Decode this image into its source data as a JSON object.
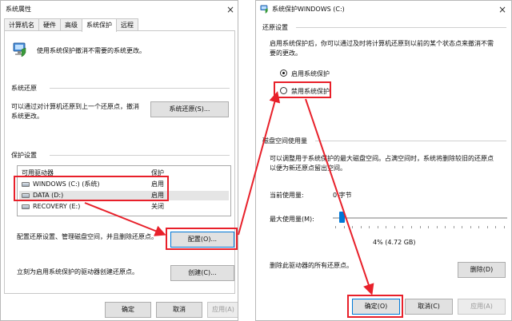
{
  "left_window": {
    "title": "系统属性",
    "close_glyph": "×",
    "tabs": [
      "计算机名",
      "硬件",
      "高级",
      "系统保护",
      "远程"
    ],
    "active_tab": "系统保护",
    "intro_text": "使用系统保护撤消不需要的系统更改。",
    "system_restore": {
      "section_label": "系统还原",
      "desc_line1": "可以通过对计算机还原到上一个还原点，撤消",
      "desc_line2": "系统更改。",
      "button_label": "系统还原(S)..."
    },
    "protection_settings": {
      "section_label": "保护设置",
      "col_drive": "可用驱动器",
      "col_protection": "保护",
      "drives": [
        {
          "name": "WINDOWS (C:) (系统)",
          "status": "启用"
        },
        {
          "name": "DATA (D:)",
          "status": "启用"
        },
        {
          "name": "RECOVERY (E:)",
          "status": "关闭"
        }
      ],
      "configure_text": "配置还原设置、管理磁盘空间，并且删除还原点。",
      "configure_button": "配置(O)...",
      "create_text": "立刻为启用系统保护的驱动器创建还原点。",
      "create_button": "创建(C)..."
    },
    "footer": {
      "ok": "确定",
      "cancel": "取消",
      "apply": "应用(A)"
    }
  },
  "right_window": {
    "title": "系统保护WINDOWS (C:)",
    "close_glyph": "×",
    "restore_settings": {
      "section_label": "还原设置",
      "desc_line1": "启用系统保护后，你可以通过及时将计算机还原到以前的某个状态点来撤消不需",
      "desc_line2": "要的更改。",
      "options": [
        {
          "label": "启用系统保护",
          "selected": true
        },
        {
          "label": "禁用系统保护",
          "selected": false
        }
      ]
    },
    "disk_usage": {
      "section_label": "磁盘空间使用量",
      "desc_line1": "可以调整用于系统保护的最大磁盘空间。占满空间时，系统将删除较旧的还原点",
      "desc_line2": "以便为新还原点留出空间。",
      "current_label": "当前使用量:",
      "current_value": "0 字节",
      "max_label": "最大使用量(M):",
      "slider_fraction": 0.04,
      "max_value": "4% (4.72 GB)",
      "delete_text": "删除此驱动器的所有还原点。",
      "delete_button": "删除(D)"
    },
    "footer": {
      "ok": "确定(O)",
      "cancel": "取消(C)",
      "apply": "应用(A)"
    }
  },
  "annotation_color": "#e8202a"
}
